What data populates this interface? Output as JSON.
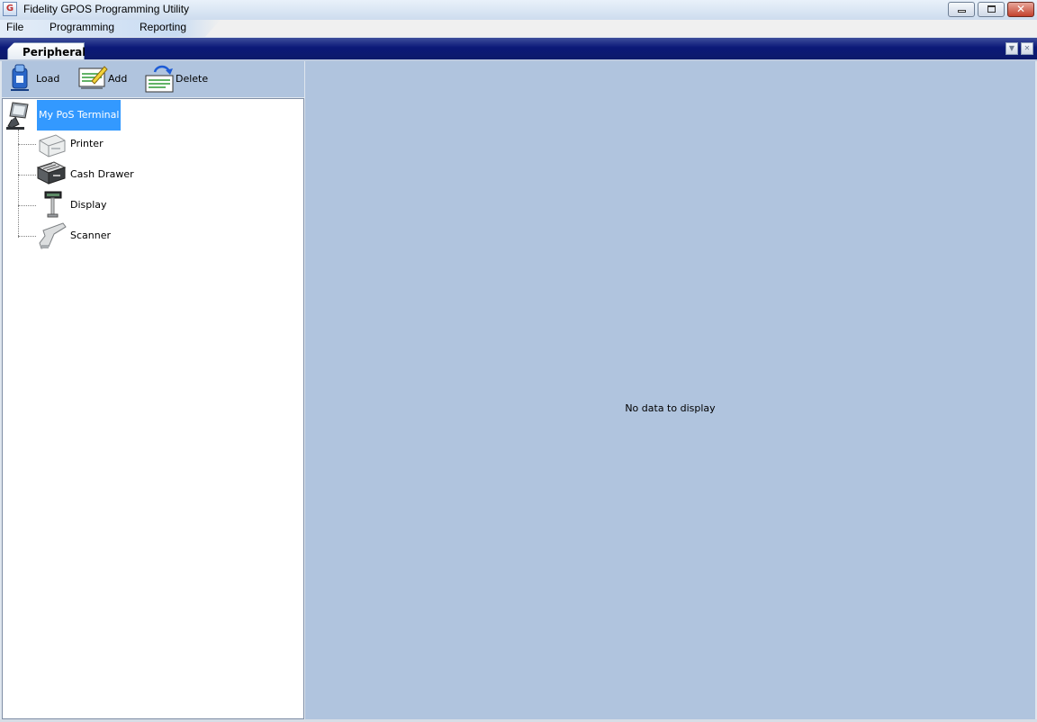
{
  "window": {
    "title": "Fidelity GPOS Programming Utility",
    "app_icon": "fidelity-g-icon"
  },
  "menu": {
    "items": [
      "File",
      "Programming",
      "Reporting"
    ]
  },
  "tabs": {
    "active": "Peripherals"
  },
  "toolbar": {
    "load_label": "Load",
    "add_label": "Add",
    "delete_label": "Delete"
  },
  "tree": {
    "root": {
      "label": "My PoS Terminal",
      "icon": "pos-terminal-icon",
      "selected": true
    },
    "children": [
      {
        "label": "Printer",
        "icon": "printer-icon"
      },
      {
        "label": "Cash Drawer",
        "icon": "cash-drawer-icon"
      },
      {
        "label": "Display",
        "icon": "pole-display-icon"
      },
      {
        "label": "Scanner",
        "icon": "barcode-scanner-icon"
      }
    ]
  },
  "content": {
    "empty_message": "No data to display"
  },
  "colors": {
    "panel_bg": "#b0c4de",
    "selection": "#3399ff",
    "tabstrip": "#0b1978"
  }
}
